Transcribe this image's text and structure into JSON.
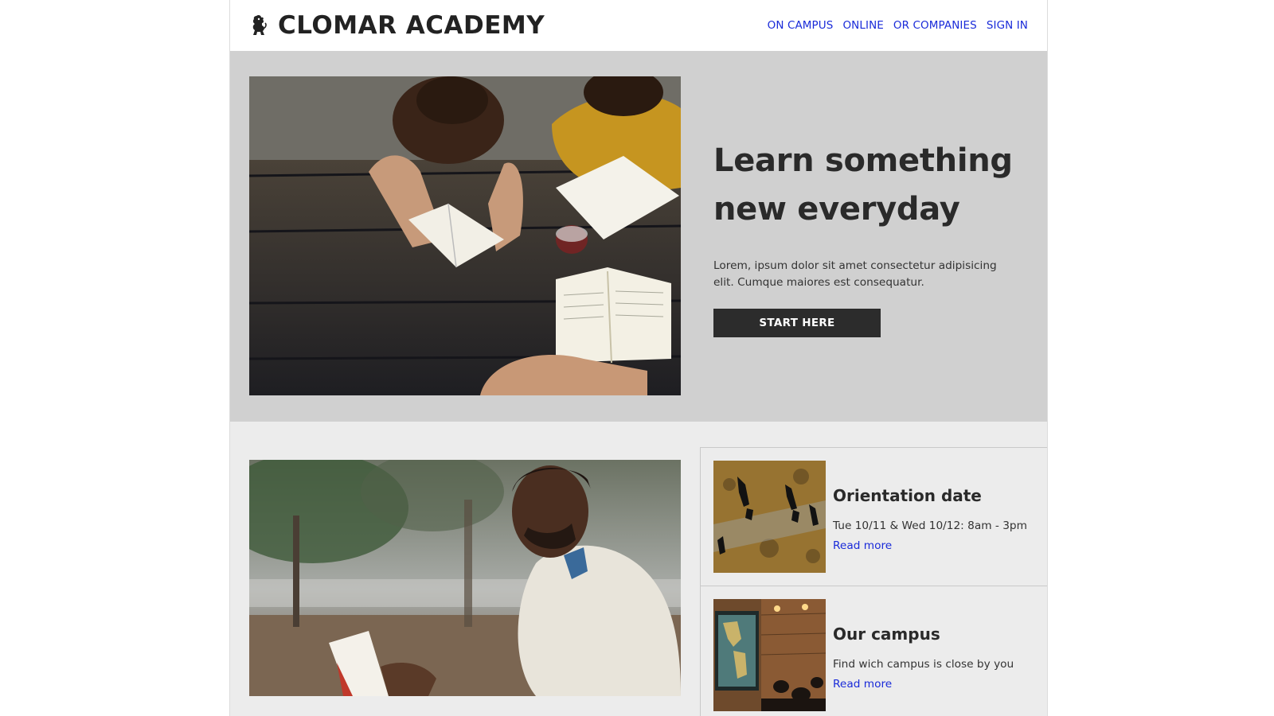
{
  "brand": {
    "icon": "lion-rampant-icon",
    "title": "CLOMAR ACADEMY"
  },
  "nav": {
    "items": [
      {
        "label": "ON CAMPUS"
      },
      {
        "label": "ONLINE"
      },
      {
        "label": "OR COMPANIES"
      },
      {
        "label": "SIGN IN"
      }
    ]
  },
  "hero": {
    "heading_line1": "Learn something",
    "heading_line2": "new everyday",
    "body": "Lorem, ipsum dolor sit amet consectetur adipisicing elit. Cumque maiores est consequatur.",
    "cta_label": "START HERE",
    "image": "students-studying-photo"
  },
  "lower": {
    "image": "man-reading-book-photo"
  },
  "cards": [
    {
      "title": "Orientation date",
      "text": "Tue 10/11 & Wed 10/12: 8am - 3pm",
      "link": "Read more",
      "image": "people-walking-shadows-photo"
    },
    {
      "title": "Our campus",
      "text": "Find wich campus is close by you",
      "link": "Read more",
      "image": "classroom-map-photo"
    }
  ],
  "colors": {
    "link": "#1a2bd9",
    "hero_bg": "#d0d0d0",
    "page_bg": "#ececec",
    "cta_bg": "#2c2c2c",
    "text": "#222222"
  }
}
